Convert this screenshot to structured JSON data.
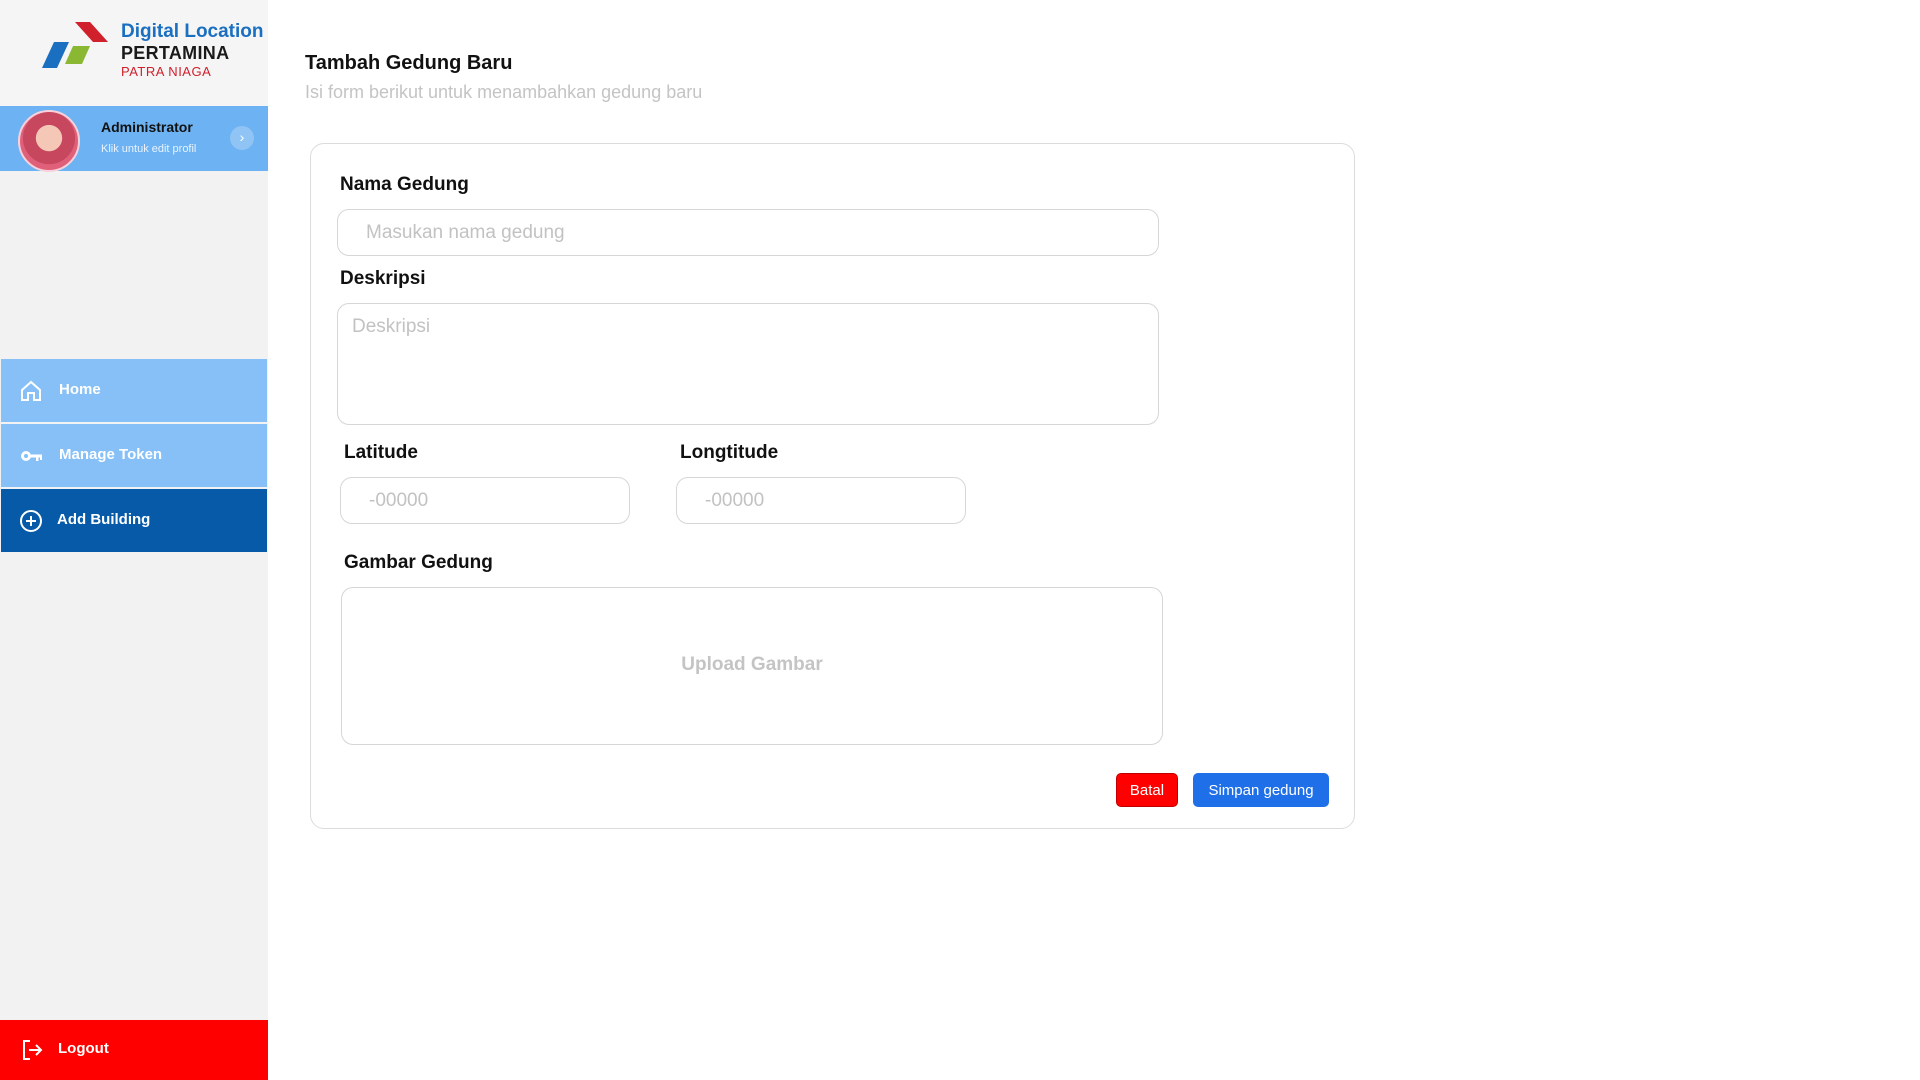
{
  "brand": {
    "line1": "Digital Location",
    "line2": "PERTAMINA",
    "line3": "PATRA NIAGA",
    "colors": {
      "blue": "#1b6fc0",
      "red": "#d0202c",
      "green": "#8ab833"
    }
  },
  "profile": {
    "name": "Administrator",
    "subtitle": "Klik untuk edit profil"
  },
  "nav": {
    "items": [
      {
        "label": "Home",
        "icon": "home-icon"
      },
      {
        "label": "Manage Token",
        "icon": "key-icon"
      },
      {
        "label": "Add Building",
        "icon": "plus-circle-icon",
        "active": true
      }
    ],
    "logout": {
      "label": "Logout",
      "icon": "logout-icon"
    }
  },
  "page": {
    "title": "Tambah Gedung Baru",
    "subtitle": "Isi form berikut untuk menambahkan gedung baru"
  },
  "form": {
    "name_label": "Nama Gedung",
    "name_placeholder": "Masukan nama gedung",
    "desc_label": "Deskripsi",
    "desc_placeholder": "Deskripsi",
    "lat_label": "Latitude",
    "lat_placeholder": "-00000",
    "lng_label": "Longtitude",
    "lng_placeholder": "-00000",
    "image_label": "Gambar Gedung",
    "upload_text": "Upload Gambar",
    "cancel_label": "Batal",
    "save_label": "Simpan gedung"
  },
  "colors": {
    "sidebar_item": "#86c0f7",
    "sidebar_active": "#075aa8",
    "logout": "#ff0000",
    "save": "#1f6fe8"
  }
}
